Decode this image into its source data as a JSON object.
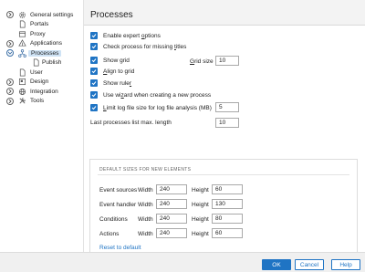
{
  "sidebar": {
    "items": [
      {
        "label": "General settings",
        "icon": "gear-icon",
        "expander": "collapsed",
        "level": 0
      },
      {
        "label": "Portals",
        "icon": "file-icon",
        "expander": "none",
        "level": 0
      },
      {
        "label": "Proxy",
        "icon": "proxy-icon",
        "expander": "none",
        "level": 0
      },
      {
        "label": "Applications",
        "icon": "applications-icon",
        "expander": "collapsed",
        "level": 0
      },
      {
        "label": "Processes",
        "icon": "processes-icon",
        "expander": "expanded",
        "level": 0,
        "selected": true
      },
      {
        "label": "Publish",
        "icon": "document-icon",
        "expander": "none",
        "level": 1
      },
      {
        "label": "User",
        "icon": "user-icon",
        "expander": "none",
        "level": 0
      },
      {
        "label": "Design",
        "icon": "design-icon",
        "expander": "collapsed",
        "level": 0
      },
      {
        "label": "Integration",
        "icon": "integration-icon",
        "expander": "collapsed",
        "level": 0
      },
      {
        "label": "Tools",
        "icon": "tools-icon",
        "expander": "collapsed",
        "level": 0
      }
    ]
  },
  "main": {
    "title": "Processes",
    "options": {
      "enable_expert": {
        "pre": "Enable expert ",
        "u": "o",
        "post": "ptions",
        "checked": true
      },
      "check_titles": {
        "pre": "Check process for missing ",
        "u": "t",
        "post": "itles",
        "checked": true
      },
      "show_grid": {
        "pre": "Show ",
        "u": "g",
        "post": "rid",
        "checked": true
      },
      "align_grid": {
        "pre": "",
        "u": "A",
        "post": "lign to grid",
        "checked": true
      },
      "show_ruler": {
        "pre": "Show rule",
        "u": "r",
        "post": "",
        "checked": true
      },
      "use_wizard": {
        "pre": "Use wi",
        "u": "z",
        "post": "ard when creating a new process",
        "checked": true
      },
      "limit_log": {
        "pre": "",
        "u": "L",
        "post": "imit log file size for log file analysis (MB)",
        "checked": true
      }
    },
    "grid_size": {
      "pre": "",
      "u": "G",
      "post": "rid size",
      "value": "10"
    },
    "limit_log_value": "5",
    "last_processes": {
      "label": "Last processes list max. length",
      "value": "10"
    },
    "defaults": {
      "title": "DEFAULT SIZES FOR NEW ELEMENTS",
      "width_label": "Width",
      "height_label": "Height",
      "rows": [
        {
          "label": "Event sources",
          "width": "240",
          "height": "60"
        },
        {
          "label": "Event handler",
          "width": "240",
          "height": "130"
        },
        {
          "label": "Conditions",
          "width": "240",
          "height": "80"
        },
        {
          "label": "Actions",
          "width": "240",
          "height": "60"
        }
      ],
      "reset_label": "Reset to default"
    }
  },
  "footer": {
    "ok_label": "OK",
    "cancel_label": "Cancel",
    "help_label": "Help"
  },
  "colors": {
    "accent": "#1f74c4",
    "selection": "#cfe3f5",
    "panel_bg": "#f3f3f3"
  }
}
